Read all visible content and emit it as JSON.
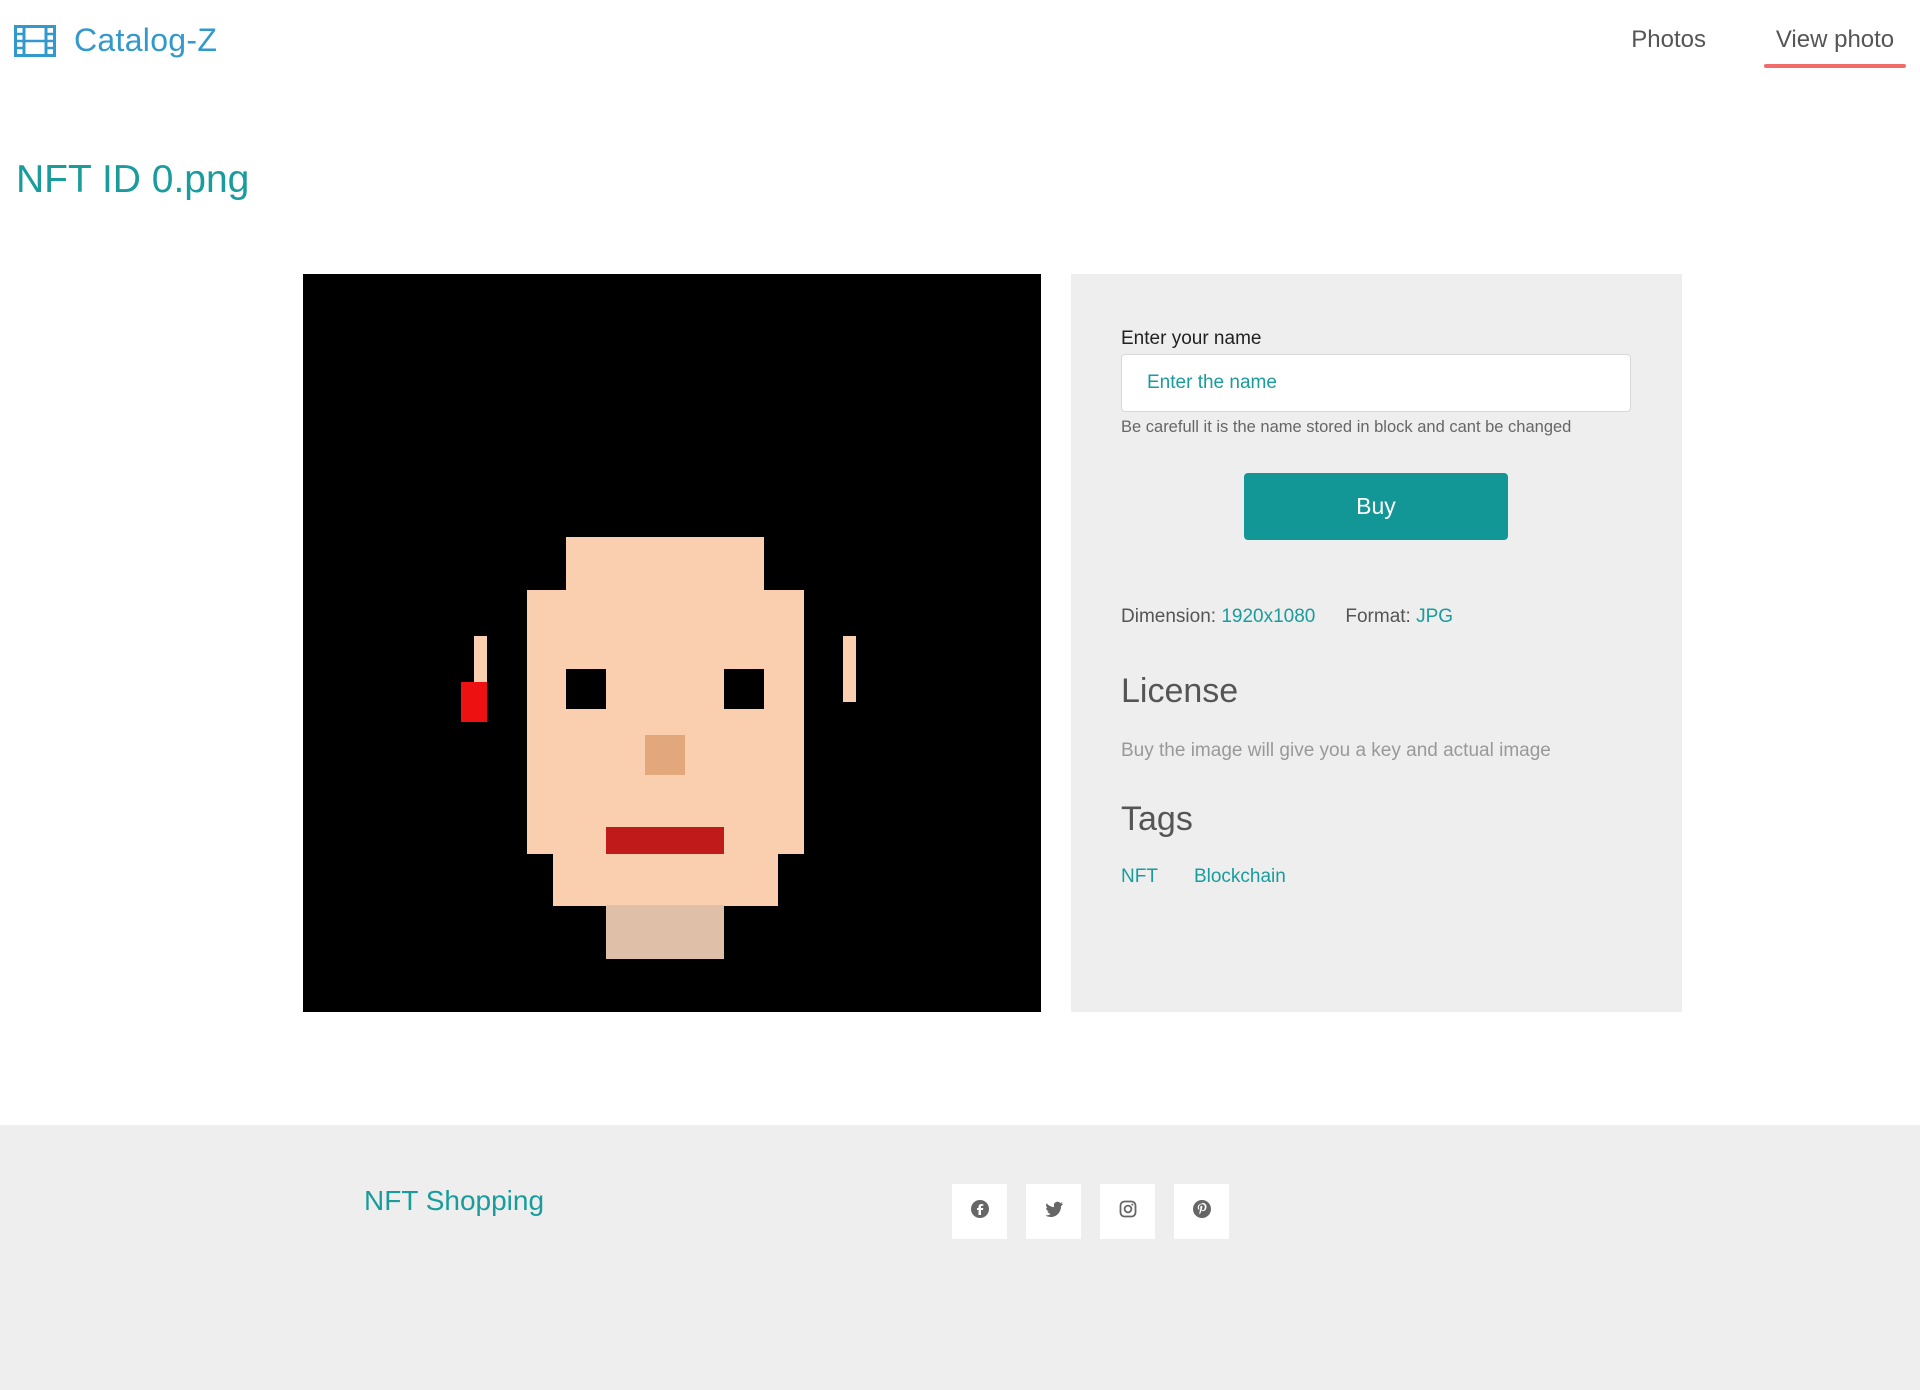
{
  "header": {
    "brand": "Catalog-Z",
    "nav": [
      {
        "label": "Photos"
      },
      {
        "label": "View photo"
      }
    ]
  },
  "page": {
    "title": "NFT ID 0.png"
  },
  "form": {
    "name_label": "Enter your name",
    "name_placeholder": "Enter the name",
    "name_value": "",
    "hint": "Be carefull it is the name stored in block and cant be changed",
    "buy_label": "Buy"
  },
  "details": {
    "dimension_label": "Dimension:",
    "dimension_value": "1920x1080",
    "format_label": "Format:",
    "format_value": "JPG",
    "license_heading": "License",
    "license_text": "Buy the image will give you a key and actual image",
    "tags_heading": "Tags",
    "tags": [
      "NFT",
      "Blockchain"
    ]
  },
  "footer": {
    "title": "NFT Shopping",
    "socials": [
      "facebook-icon",
      "twitter-icon",
      "instagram-icon",
      "pinterest-icon"
    ]
  },
  "colors": {
    "accent": "#1a9c9c",
    "brand": "#3399cc",
    "button": "#129696",
    "nav_underline": "#f26b6b",
    "panel_bg": "#eeeeee",
    "skin": "#f9cfb0",
    "lips": "#c11a1a",
    "nose": "#e2a77a",
    "neck": "#e0bfa8",
    "earring": "#ee1111"
  }
}
